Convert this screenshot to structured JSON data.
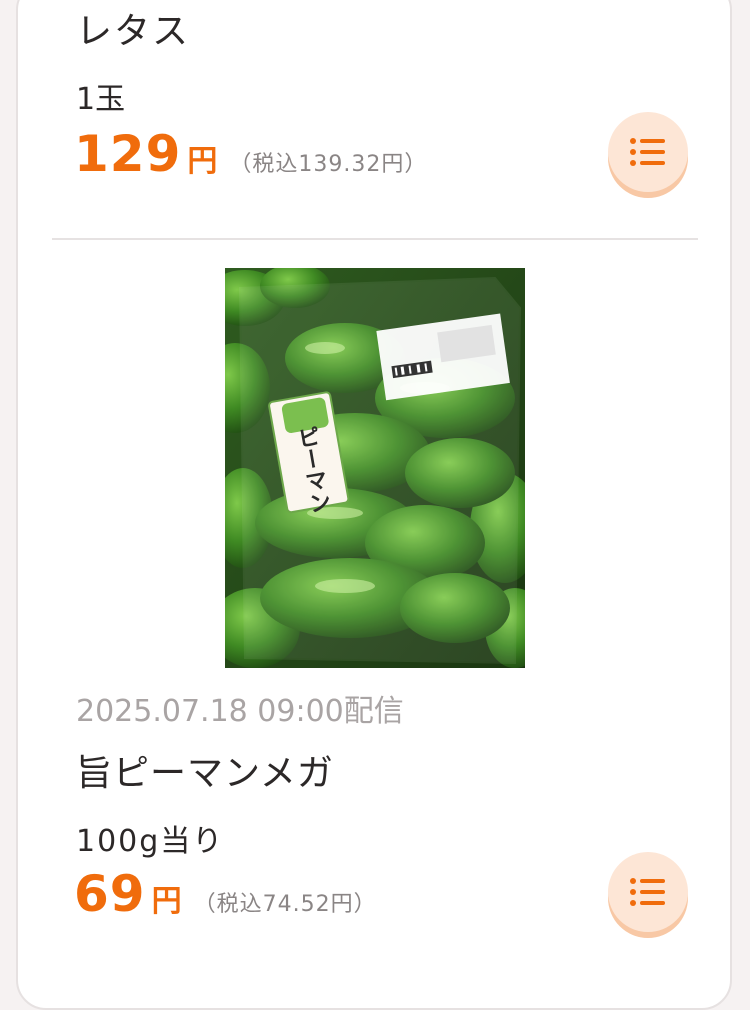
{
  "items": [
    {
      "name": "レタス",
      "unit": "1玉",
      "price": "129",
      "currency": "円",
      "tax_included": "（税込139.32円）"
    },
    {
      "date": "2025.07.18 09:00配信",
      "name": "旨ピーマンメガ",
      "unit": "100g当り",
      "price": "69",
      "currency": "円",
      "tax_included": "（税込74.52円）",
      "image_label": "ピーマン"
    }
  ],
  "icons": {
    "menu_button": "list-icon"
  },
  "colors": {
    "price": "#f06c0c",
    "menu_button_bg": "#fde6d6",
    "background": "#f6f2f2"
  }
}
